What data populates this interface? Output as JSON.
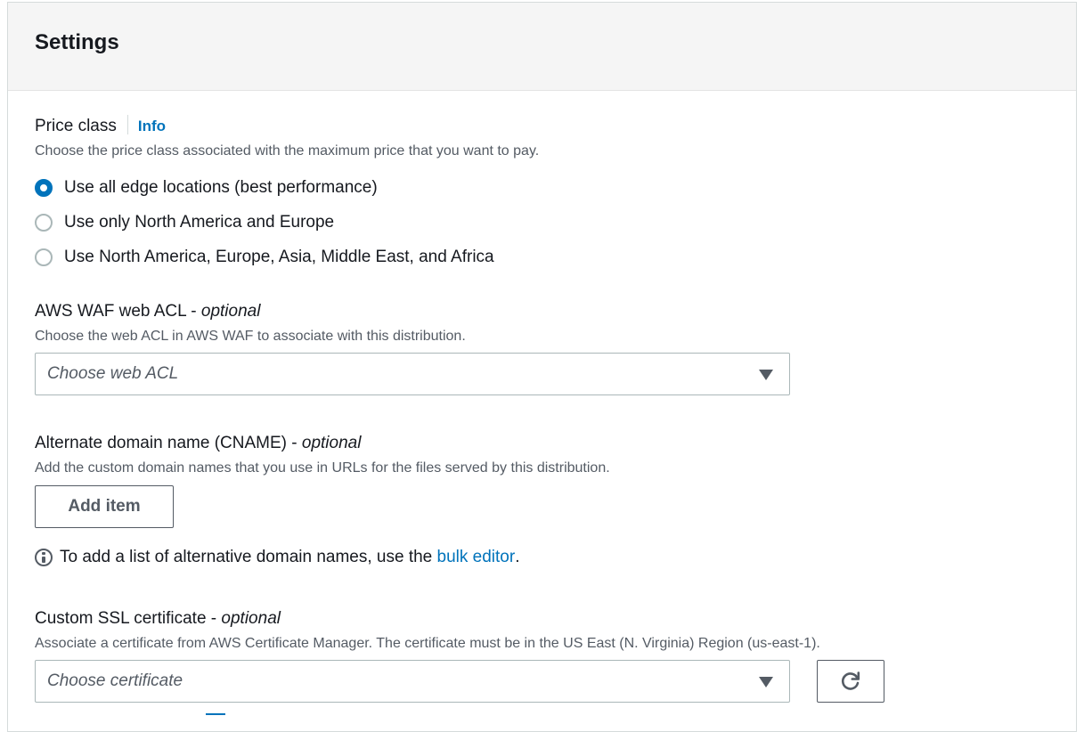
{
  "panel": {
    "title": "Settings"
  },
  "price_class": {
    "label": "Price class",
    "info_link": "Info",
    "description": "Choose the price class associated with the maximum price that you want to pay.",
    "options": [
      {
        "label": "Use all edge locations (best performance)",
        "selected": true
      },
      {
        "label": "Use only North America and Europe",
        "selected": false
      },
      {
        "label": "Use North America, Europe, Asia, Middle East, and Africa",
        "selected": false
      }
    ]
  },
  "waf": {
    "label": "AWS WAF web ACL - ",
    "optional": "optional",
    "description": "Choose the web ACL in AWS WAF to associate with this distribution.",
    "placeholder": "Choose web ACL"
  },
  "cname": {
    "label": "Alternate domain name (CNAME) - ",
    "optional": "optional",
    "description": "Add the custom domain names that you use in URLs for the files served by this distribution.",
    "add_button": "Add item",
    "hint_prefix": "To add a list of alternative domain names, use the ",
    "hint_link": "bulk editor",
    "hint_suffix": "."
  },
  "ssl": {
    "label": "Custom SSL certificate - ",
    "optional": "optional",
    "description": "Associate a certificate from AWS Certificate Manager. The certificate must be in the US East (N. Virginia) Region (us-east-1).",
    "placeholder": "Choose certificate"
  },
  "colors": {
    "accent": "#0073bb",
    "text": "#16191f",
    "muted": "#545b64",
    "border": "#aab7b8",
    "header_bg": "#f5f5f5"
  }
}
